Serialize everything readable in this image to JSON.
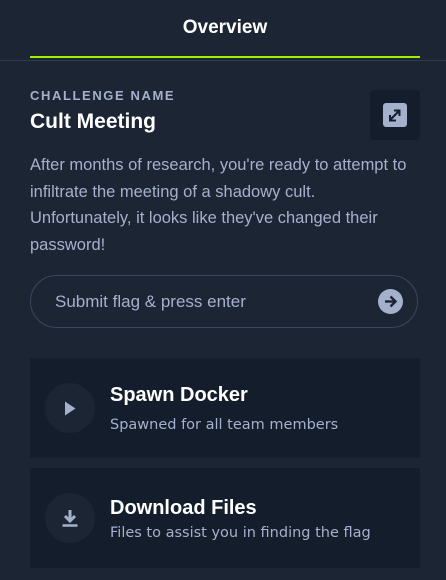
{
  "tabs": {
    "overview": "Overview"
  },
  "challenge": {
    "label": "CHALLENGE NAME",
    "name": "Cult Meeting",
    "description": "After months of research, you're ready to attempt to infiltrate the meeting of a shadowy cult. Unfortunately, it looks like they've changed their password!"
  },
  "flag_input": {
    "placeholder": "Submit flag & press enter",
    "value": ""
  },
  "actions": [
    {
      "title": "Spawn Docker",
      "subtitle": "Spawned for all team members",
      "icon": "play-icon"
    },
    {
      "title": "Download Files",
      "subtitle": "Files to assist you in finding the flag",
      "icon": "download-icon"
    }
  ],
  "icons": {
    "share": "share-icon",
    "submit": "arrow-right-icon"
  },
  "colors": {
    "accent": "#9fef00",
    "background": "#1c2534",
    "card": "#141d2b",
    "muted_text": "#a4b1cd"
  }
}
